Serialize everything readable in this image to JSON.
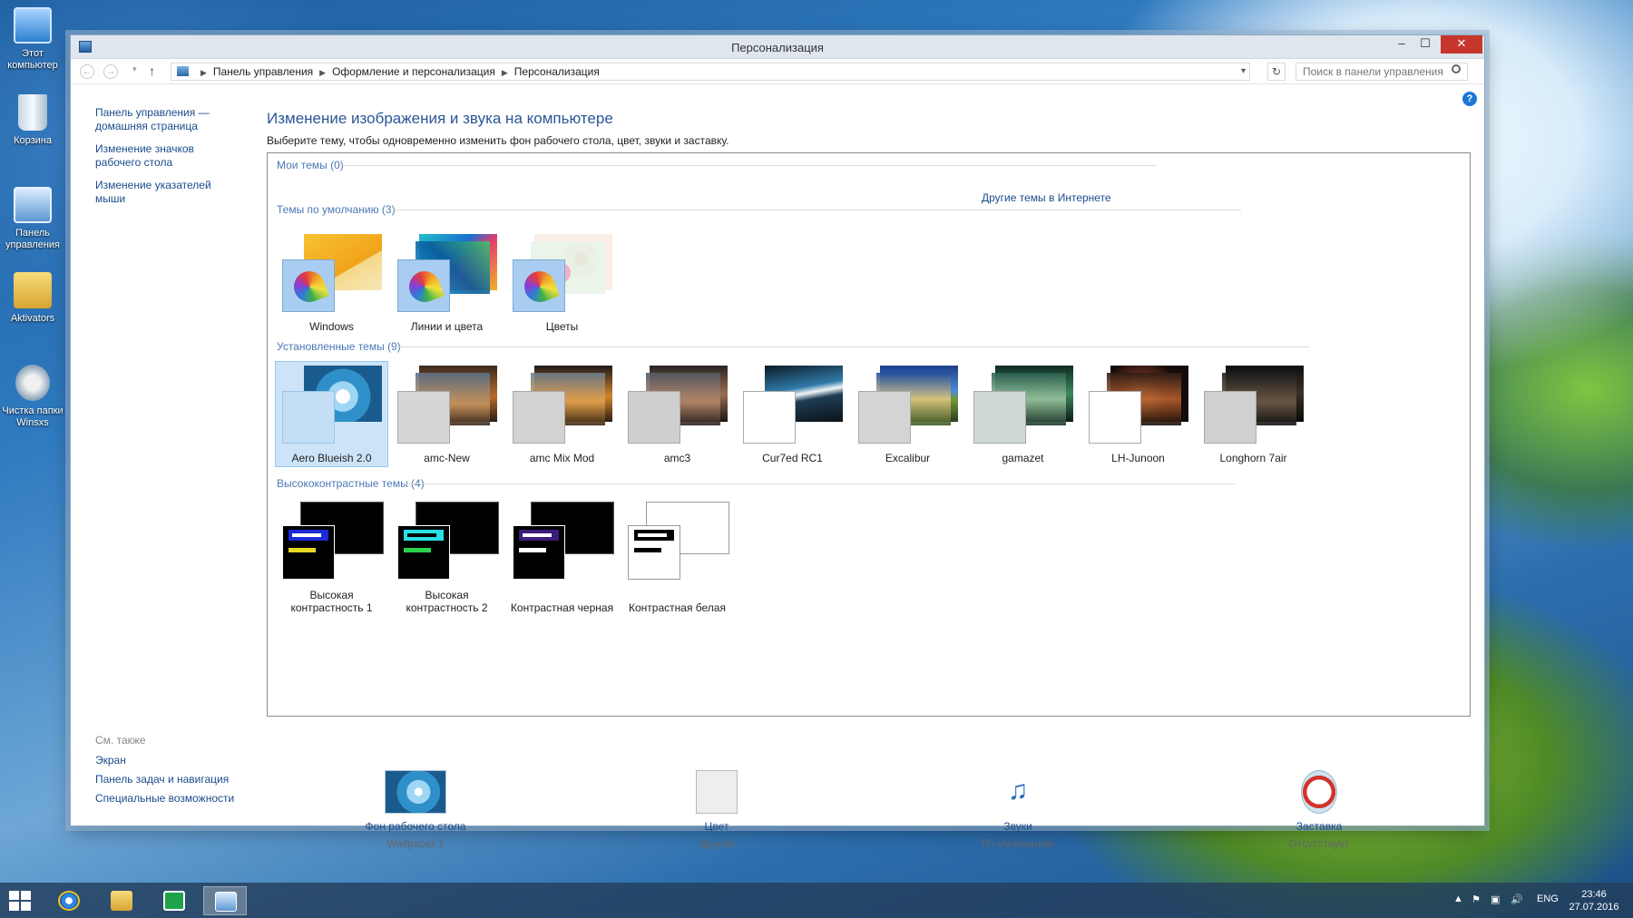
{
  "desktop": {
    "icons": [
      {
        "label": "Этот компьютер",
        "icon": "computer-icon"
      },
      {
        "label": "Корзина",
        "icon": "recycle-bin-icon"
      },
      {
        "label": "Панель управления",
        "icon": "control-panel-icon"
      },
      {
        "label": "Aktivators",
        "icon": "folder-icon"
      },
      {
        "label": "Чистка папки Winsxs",
        "icon": "cleanup-icon"
      }
    ]
  },
  "window": {
    "title": "Персонализация",
    "controls": {
      "minimize": "‒",
      "maximize": "☐",
      "close": "✕"
    }
  },
  "address": {
    "crumbs": [
      "Панель управления",
      "Оформление и персонализация",
      "Персонализация"
    ],
    "search_placeholder": "Поиск в панели управления"
  },
  "sidebar": {
    "links": [
      "Панель управления — домашняя страница",
      "Изменение значков рабочего стола",
      "Изменение указателей мыши"
    ],
    "see_also_title": "См. также",
    "see_also": [
      "Экран",
      "Панель задач и навигация",
      "Специальные возможности"
    ]
  },
  "main": {
    "heading": "Изменение изображения и звука на компьютере",
    "subtitle": "Выберите тему, чтобы одновременно изменить фон рабочего стола, цвет, звуки и заставку.",
    "online_link": "Другие темы в Интернете",
    "sections": {
      "my": "Мои темы (0)",
      "default": "Темы по умолчанию (3)",
      "installed": "Установленные темы (9)",
      "high_contrast": "Высококонтрастные темы (4)"
    },
    "default_themes": [
      "Windows",
      "Линии и цвета",
      "Цветы"
    ],
    "installed_themes": [
      "Aero Blueish 2.0",
      "amc-New",
      "amc Mix Mod",
      "amc3",
      "Cur7ed RC1",
      "Excalibur",
      "gamazet",
      "LH-Junoon",
      "Longhorn 7air"
    ],
    "selected_theme": "Aero Blueish 2.0",
    "high_contrast_themes": [
      "Высокая контрастность 1",
      "Высокая контрастность 2",
      "Контрастная черная",
      "Контрастная белая"
    ]
  },
  "bottom": [
    {
      "label": "Фон рабочего стола",
      "value": "Wallpaper 1",
      "icon": "wallpaper-icon"
    },
    {
      "label": "Цвет",
      "value": "Другой",
      "icon": "color-icon"
    },
    {
      "label": "Звуки",
      "value": "По умолчанию",
      "icon": "sounds-icon"
    },
    {
      "label": "Заставка",
      "value": "Отсутствует",
      "icon": "screensaver-icon"
    }
  ],
  "taskbar": {
    "language": "ENG",
    "time": "23:46",
    "date": "27.07.2016"
  },
  "colors": {
    "link": "#1a4c8c",
    "heading": "#2a5596",
    "selection": "#cde4f8",
    "close_button": "#c7362c"
  }
}
